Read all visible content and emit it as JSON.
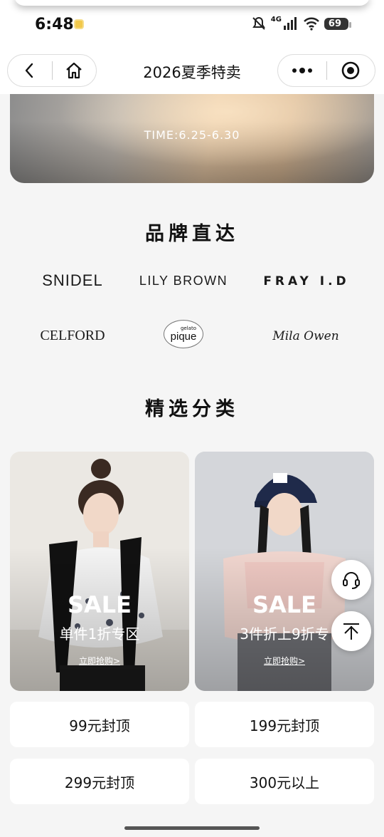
{
  "status_bar": {
    "time": "6:48",
    "network": "4G",
    "battery": "69"
  },
  "nav": {
    "title": "2026夏季特卖"
  },
  "banner": {
    "time_text": "TIME:6.25-6.30"
  },
  "brands_section": {
    "title": "品牌直达",
    "brands": [
      "SNIDEL",
      "LILY BROWN",
      "FRAY I.D",
      "CELFORD",
      "gelato",
      "pique",
      "Mila Owen"
    ]
  },
  "categories_section": {
    "title": "精选分类",
    "cards": [
      {
        "sale": "SALE",
        "subtitle": "单件1折专区",
        "link": "立即抢购>"
      },
      {
        "sale": "SALE",
        "subtitle": "3件折上9折专",
        "link": "立即抢购>"
      }
    ],
    "price_buttons": [
      "99元封顶",
      "199元封顶",
      "299元封顶",
      "300元以上"
    ]
  }
}
